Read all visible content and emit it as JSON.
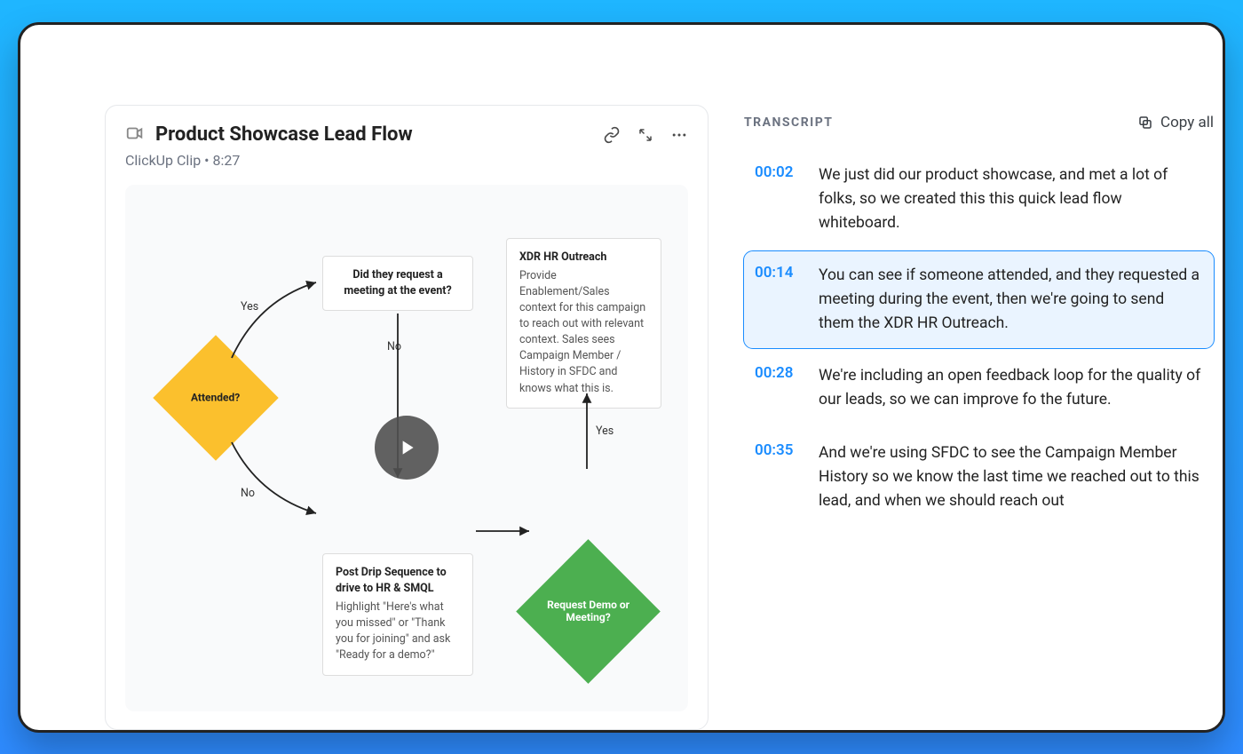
{
  "header": {
    "title": "Product Showcase Lead Flow",
    "source": "ClickUp Clip",
    "duration": "8:27"
  },
  "flow": {
    "attended_label": "Attended?",
    "yes_label": "Yes",
    "no_label": "No",
    "box_meeting_title": "Did they request a meeting at the event?",
    "box_outreach_title": "XDR HR Outreach",
    "box_outreach_body": "Provide Enablement/Sales context for this campaign to reach out with relevant context. Sales sees Campaign Member / History in SFDC and knows what this is.",
    "box_drip_title": "Post Drip Sequence to drive to HR & SMQL",
    "box_drip_body": "Highlight \"Here's what you missed\" or \"Thank you for joining\" and ask \"Ready for a demo?\"",
    "demo_label": "Request Demo or Meeting?"
  },
  "transcript": {
    "label": "TRANSCRIPT",
    "copy_label": "Copy all",
    "items": [
      {
        "ts": "00:02",
        "text": "We just did our product showcase, and met a lot of folks, so we created this this quick lead flow whiteboard."
      },
      {
        "ts": "00:14",
        "text": "You can see if someone attended, and they requested a meeting during the event, then we're going to send them the XDR HR Outreach."
      },
      {
        "ts": "00:28",
        "text": "We're including an open feedback loop for the quality of our leads, so we can improve fo the future."
      },
      {
        "ts": "00:35",
        "text": "And we're using SFDC to see the Campaign Member History so we know the last time we reached out to this lead, and when we should reach out"
      }
    ],
    "active_index": 1
  }
}
